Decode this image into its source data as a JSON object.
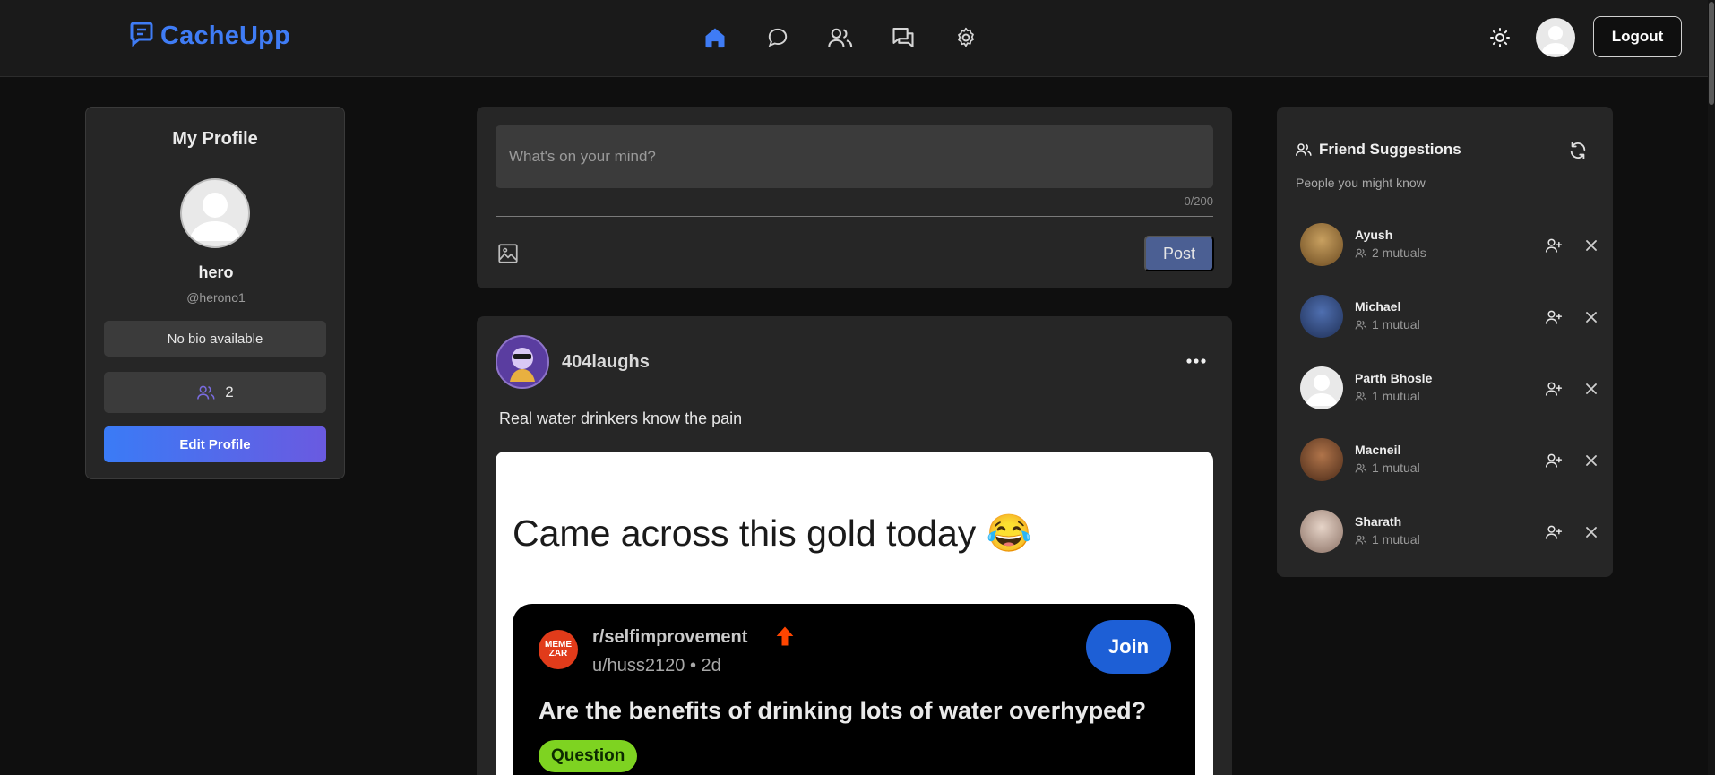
{
  "header": {
    "app_name": "CacheUpp",
    "nav": [
      {
        "name": "home-icon",
        "label": "Home",
        "active": true
      },
      {
        "name": "chat-icon",
        "label": "Chats"
      },
      {
        "name": "friends-icon",
        "label": "Friends"
      },
      {
        "name": "messages-icon",
        "label": "Messages"
      },
      {
        "name": "settings-icon",
        "label": "Settings"
      }
    ],
    "logout_label": "Logout"
  },
  "profile": {
    "title": "My Profile",
    "name": "hero",
    "handle": "@herono1",
    "bio": "No bio available",
    "friend_count": "2",
    "edit_label": "Edit Profile"
  },
  "composer": {
    "placeholder": "What's on your mind?",
    "char_count": "0/200",
    "post_label": "Post"
  },
  "post": {
    "author": "404laughs",
    "text": "Real water drinkers know the pain",
    "image": {
      "caption": "Came across this gold today 😂",
      "logo_text": "MEME ZAR",
      "subreddit": "r/selfimprovement",
      "meta": "u/huss2120 • 2d",
      "join_label": "Join",
      "title": "Are the benefits of drinking lots of water overhyped?",
      "flair": "Question"
    }
  },
  "suggestions": {
    "title": "Friend Suggestions",
    "subtitle": "People you might know",
    "people": [
      {
        "name": "Ayush",
        "mutual": "2 mutuals"
      },
      {
        "name": "Michael",
        "mutual": "1 mutual"
      },
      {
        "name": "Parth Bhosle",
        "mutual": "1 mutual"
      },
      {
        "name": "Macneil",
        "mutual": "1 mutual"
      },
      {
        "name": "Sharath",
        "mutual": "1 mutual"
      }
    ]
  },
  "colors": {
    "accent": "#3f7cf5",
    "background": "#0f0f0f",
    "card": "#262626",
    "flair": "#7ed321"
  }
}
